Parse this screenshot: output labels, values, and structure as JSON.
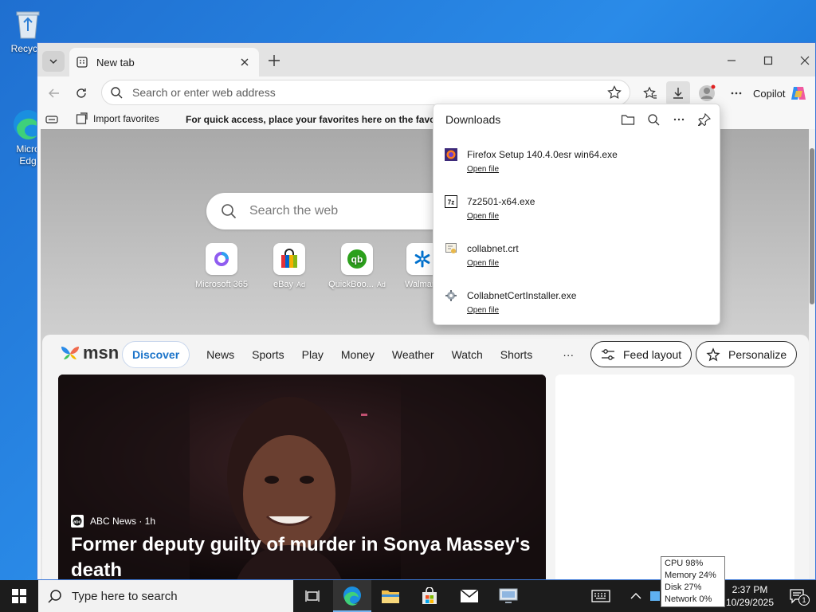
{
  "desktop": {
    "icons": [
      {
        "label": "Recycle"
      },
      {
        "label": "Micro\nEdg"
      }
    ]
  },
  "browser": {
    "tab": {
      "title": "New tab"
    },
    "address": {
      "placeholder": "Search or enter web address"
    },
    "copilot_label": "Copilot",
    "favorites": {
      "import_label": "Import favorites",
      "hint": "For quick access, place your favorites here on the favorite"
    }
  },
  "newtab": {
    "search_placeholder": "Search the web",
    "tiles": [
      {
        "label": "Microsoft 365",
        "ad": ""
      },
      {
        "label": "eBay",
        "ad": "Ad"
      },
      {
        "label": "QuickBoo...",
        "ad": "Ad"
      },
      {
        "label": "Walmar",
        "ad": ""
      }
    ]
  },
  "msn": {
    "logo": "msn",
    "discover": "Discover",
    "nav": [
      "News",
      "Sports",
      "Play",
      "Money",
      "Weather",
      "Watch",
      "Shorts",
      "···"
    ],
    "feed_layout": "Feed layout",
    "personalize": "Personalize",
    "hero": {
      "source": "ABC News · 1h",
      "headline": "Former deputy guilty of murder in Sonya Massey's death"
    }
  },
  "downloads": {
    "title": "Downloads",
    "items": [
      {
        "name": "Firefox Setup 140.4.0esr win64.exe",
        "action": "Open file"
      },
      {
        "name": "7z2501-x64.exe",
        "action": "Open file"
      },
      {
        "name": "collabnet.crt",
        "action": "Open file"
      },
      {
        "name": "CollabnetCertInstaller.exe",
        "action": "Open file"
      }
    ]
  },
  "taskbar": {
    "search_placeholder": "Type here to search",
    "time": "2:37 PM",
    "date": "10/29/2025",
    "notification_count": "1"
  },
  "perf_monitor": {
    "cpu": "CPU 98%",
    "memory": "Memory 24%",
    "disk": "Disk 27%",
    "network": "Network 0%"
  },
  "colors": {
    "accent": "#1a73c9",
    "edge_blue": "#0c78d4",
    "taskbar": "#1c1c1c"
  }
}
